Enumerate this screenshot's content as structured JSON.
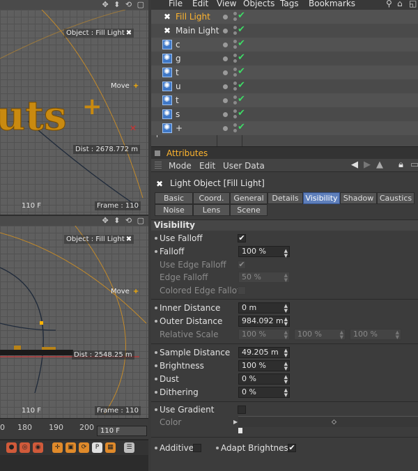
{
  "menu": [
    "File",
    "Edit",
    "View",
    "Objects",
    "Tags",
    "Bookmarks"
  ],
  "viewport_top": {
    "object_label": "Object : Fill Light",
    "move_label": "Move",
    "dist": "Dist : 2678.772 m",
    "frame_left": "110 F",
    "frame_right": "Frame : 110"
  },
  "viewport_bottom": {
    "object_label": "Object : Fill Light",
    "move_label": "Move",
    "dist": "Dist : 2548.25 m",
    "frame_left": "110 F",
    "frame_right": "Frame : 110"
  },
  "timeline": {
    "ticks": [
      "0",
      "180",
      "190",
      "200"
    ],
    "current": "110 F"
  },
  "objects": [
    {
      "name": "Fill Light",
      "selected": true
    },
    {
      "name": "Main Light",
      "selected": false
    },
    {
      "name": "c",
      "selected": false
    },
    {
      "name": "g",
      "selected": false
    },
    {
      "name": "t",
      "selected": false
    },
    {
      "name": "u",
      "selected": false
    },
    {
      "name": "t",
      "selected": false
    },
    {
      "name": "s",
      "selected": false
    },
    {
      "name": "+",
      "selected": false
    }
  ],
  "attributes": {
    "title": "Attributes",
    "menu": [
      "Mode",
      "Edit",
      "User Data"
    ],
    "object_title": "Light Object [Fill Light]",
    "tabs_row1": [
      "Basic",
      "Coord.",
      "General",
      "Details",
      "Visibility",
      "Shadow",
      "Caustics"
    ],
    "tabs_row2": [
      "Noise",
      "Lens",
      "Scene"
    ],
    "active_tab": "Visibility",
    "section": "Visibility",
    "use_falloff": "Use Falloff",
    "falloff": "Falloff",
    "falloff_value": "100 %",
    "use_edge_falloff": "Use Edge Falloff",
    "edge_falloff": "Edge Falloff",
    "edge_falloff_value": "50 %",
    "colored_edge_falloff": "Colored Edge Falloff",
    "inner_distance": "Inner Distance",
    "inner_distance_value": "0 m",
    "outer_distance": "Outer Distance",
    "outer_distance_value": "984.092 m",
    "relative_scale": "Relative Scale",
    "relative_scale_values": [
      "100 %",
      "100 %",
      "100 %"
    ],
    "sample_distance": "Sample Distance",
    "sample_distance_value": "49.205 m",
    "brightness": "Brightness",
    "brightness_value": "100 %",
    "dust": "Dust",
    "dust_value": "0 %",
    "dithering": "Dithering",
    "dithering_value": "0 %",
    "use_gradient": "Use Gradient",
    "color": "Color",
    "additive": "Additive",
    "adapt_brightness": "Adapt Brightness"
  },
  "colors": {
    "accent": "#ffb52e",
    "active_tab": "#5e7fbb",
    "check": "#3edc66"
  }
}
